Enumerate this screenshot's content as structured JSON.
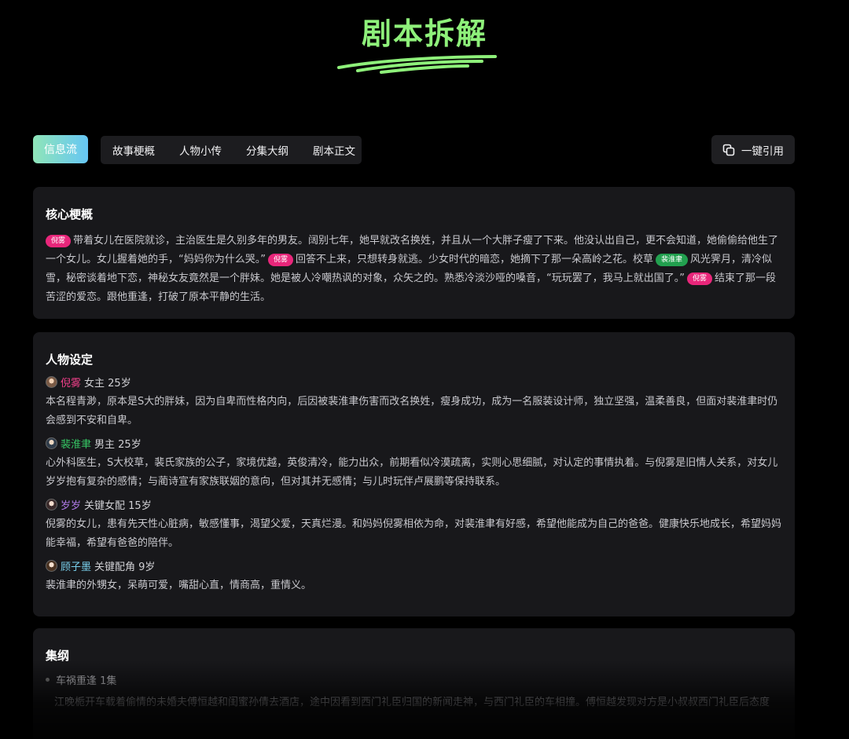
{
  "header": {
    "title": "剧本拆解"
  },
  "toolbar": {
    "feed_label": "信息流",
    "tabs": [
      {
        "label": "故事梗概"
      },
      {
        "label": "人物小传"
      },
      {
        "label": "分集大纲"
      },
      {
        "label": "剧本正文"
      }
    ],
    "quote_label": "一键引用"
  },
  "synopsis": {
    "title": "核心梗概",
    "tag_a": "倪雾",
    "tag_b": "裴淮聿",
    "seg1": "带着女儿在医院就诊，主治医生是久别多年的男友。阔别七年，她早就改名换姓，并且从一个大胖子瘦了下来。他没认出自己，更不会知道，她偷偷给他生了一个女儿。女儿握着她的手，“妈妈你为什么哭。”",
    "seg2": "回答不上来，只想转身就逃。少女时代的暗恋，她摘下了那一朵高岭之花。校草",
    "seg3": "风光霁月，清冷似雪，秘密谈着地下恋，神秘女友竟然是一个胖妹。她是被人冷嘲热讽的对象，众矢之的。熟悉冷淡沙哑的嗓音，“玩玩罢了，我马上就出国了。”",
    "seg4": "结束了那一段苦涩的爱恋。跟他重逢，打破了原本平静的生活。"
  },
  "characters": {
    "title": "人物设定",
    "items": [
      {
        "name": "倪雾",
        "role": "女主 25岁",
        "desc": "本名程青渺，原本是S大的胖妹，因为自卑而性格内向，后因被裴淮聿伤害而改名换姓，瘦身成功，成为一名服装设计师，独立坚强，温柔善良，但面对裴淮聿时仍会感到不安和自卑。"
      },
      {
        "name": "裴淮聿",
        "role": "男主 25岁",
        "desc": "心外科医生，S大校草，裴氏家族的公子，家境优越，英俊清冷，能力出众，前期看似冷漠疏离，实则心思细腻，对认定的事情执着。与倪雾是旧情人关系，对女儿岁岁抱有复杂的感情；与蔺诗宣有家族联姻的意向，但对其并无感情；与儿时玩伴卢展鹏等保持联系。"
      },
      {
        "name": "岁岁",
        "role": "关键女配 15岁",
        "desc": "倪雾的女儿，患有先天性心脏病，敏感懂事，渴望父爱，天真烂漫。和妈妈倪雾相依为命，对裴淮聿有好感，希望他能成为自己的爸爸。健康快乐地成长，希望妈妈能幸福，希望有爸爸的陪伴。"
      },
      {
        "name": "顾子墨",
        "role": "关键配角 9岁",
        "desc": "裴淮聿的外甥女，呆萌可爱，嘴甜心直，情商高，重情义。"
      }
    ]
  },
  "outline": {
    "title": "集纲",
    "episode": "车祸重逢 1集",
    "desc": "江晚栀开车载着偷情的未婚夫傅恒越和闺蜜孙倩去酒店，途中因看到西门礼臣归国的新闻走神，与西门礼臣的车相撞。傅恒越发现对方是小叔叔西门礼臣后态度"
  },
  "colors": {
    "title_green": "#8ef07a",
    "tag_pink": "#e8267a",
    "tag_green": "#22a04f",
    "card_bg": "#18181b"
  }
}
